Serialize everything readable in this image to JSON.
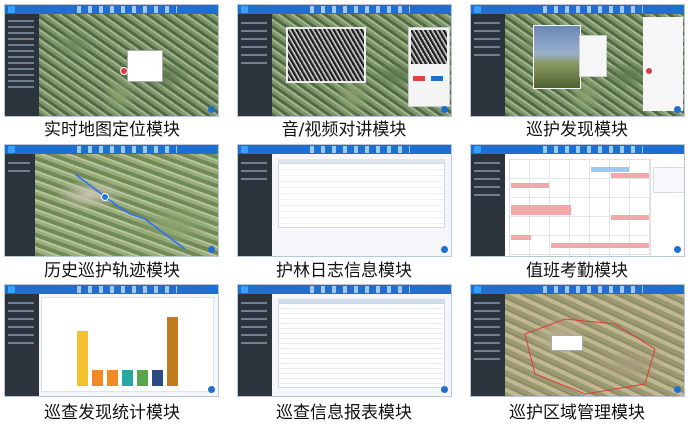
{
  "captions": [
    "实时地图定位模块",
    "音/视频对讲模块",
    "巡护发现模块",
    "历史巡护轨迹模块",
    "护林日志信息模块",
    "值班考勤模块",
    "巡查发现统计模块",
    "巡查信息报表模块",
    "巡护区域管理模块"
  ],
  "colors": {
    "header_blue": "#1f6fd0",
    "sidebar_dark": "#2b333d",
    "bar_yellow": "#f2c12e",
    "bar_orange": "#f08a24",
    "bar_teal": "#27a9a1",
    "bar_green": "#5aa64b",
    "bar_navy": "#2c4a86",
    "bar_brown": "#c27a1e",
    "duty_red": "#f2a8a8",
    "duty_blue": "#9ec9ec"
  },
  "chart_data": {
    "type": "bar",
    "categories": [
      "",
      "",
      "",
      "",
      "",
      "",
      ""
    ],
    "values": [
      0.62,
      0.18,
      0.18,
      0.18,
      0.18,
      0.18,
      0.78
    ],
    "colors": [
      "#f2c12e",
      "#f08a24",
      "#f08a24",
      "#27a9a1",
      "#5aa64b",
      "#2c4a86",
      "#c27a1e"
    ]
  }
}
